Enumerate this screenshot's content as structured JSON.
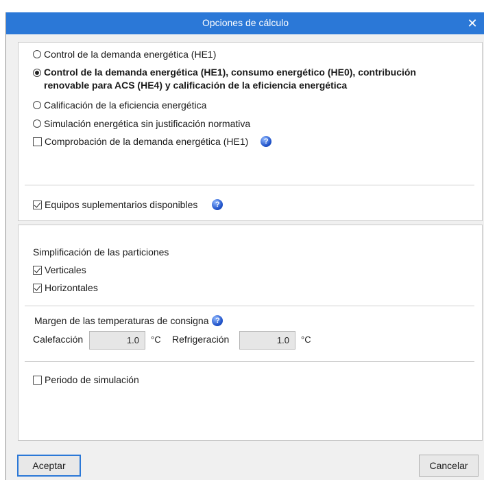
{
  "window": {
    "title": "Opciones de cálculo",
    "close_glyph": "✕"
  },
  "mode_options": [
    {
      "label": "Control de la demanda energética (HE1)",
      "selected": false
    },
    {
      "label": "Control de la demanda energética (HE1), consumo energético (HE0), contribución",
      "label_line2": "renovable para ACS (HE4) y calificación de la eficiencia energética",
      "selected": true
    },
    {
      "label": "Calificación de la eficiencia energética",
      "selected": false
    },
    {
      "label": "Simulación energética sin justificación normativa",
      "selected": false
    }
  ],
  "check_demand": {
    "label": "Comprobación de la demanda energética (HE1)",
    "checked": false
  },
  "check_equipment": {
    "label": "Equipos suplementarios disponibles",
    "checked": true
  },
  "simplification": {
    "heading": "Simplificación de las particiones",
    "verticals": {
      "label": "Verticales",
      "checked": true
    },
    "horizontals": {
      "label": "Horizontales",
      "checked": true
    }
  },
  "setpoint_margin": {
    "heading": "Margen de las temperaturas de consigna",
    "heating_label": "Calefacción",
    "heating_value": "1.0",
    "cooling_label": "Refrigeración",
    "cooling_value": "1.0",
    "unit": "°C"
  },
  "simulation_period": {
    "label": "Periodo de simulación",
    "checked": false
  },
  "help_glyph": "?",
  "buttons": {
    "accept": "Aceptar",
    "cancel": "Cancelar"
  },
  "colors": {
    "titlebar": "#2b78d7",
    "primary_border": "#2b78d7"
  }
}
